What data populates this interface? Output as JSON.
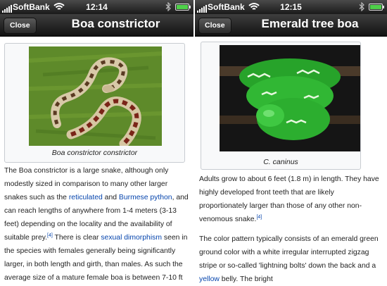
{
  "left": {
    "status": {
      "carrier": "SoftBank",
      "time": "12:14"
    },
    "nav": {
      "close_label": "Close",
      "title": "Boa constrictor"
    },
    "figure": {
      "caption": "Boa constrictor constrictor"
    },
    "article": {
      "p1": {
        "t1": "The Boa constrictor is a large snake, although only modestly sized in comparison to many other larger snakes such as the ",
        "link1": "reticulated",
        "t2": " and ",
        "link2": "Burmese python",
        "t3": ", and can reach lengths of anywhere from 1-4 meters (3-13 feet) depending on the locality and the availability of suitable prey.",
        "ref": "[4]",
        "t4": " There is clear ",
        "link3": "sexual dimorphism",
        "t5": " seen in the species with females generally being significantly larger, in both length and girth, than males. As such the average size of a mature female boa is between 7-10 ft"
      }
    }
  },
  "right": {
    "status": {
      "carrier": "SoftBank",
      "time": "12:15"
    },
    "nav": {
      "close_label": "Close",
      "title": "Emerald tree boa"
    },
    "figure": {
      "caption": "C. caninus"
    },
    "article": {
      "p1": {
        "t1": "Adults grow to about 6 feet (1.8 m) in length. They have highly developed front teeth that are likely proportionately larger than those of any other non-venomous snake.",
        "ref": "[4]"
      },
      "p2": {
        "t1": "The color pattern typically consists of an emerald green ground color with a white irregular interrupted zigzag stripe or so-called 'lightning bolts' down the back and a ",
        "link1": "yellow",
        "t2": " belly. The bright"
      }
    }
  },
  "colors": {
    "link": "#0645ad",
    "navbar": "#1e1e1e",
    "battery": "#4fd14a"
  },
  "icons": [
    "signal-icon",
    "wifi-icon",
    "bluetooth-icon",
    "battery-icon"
  ]
}
